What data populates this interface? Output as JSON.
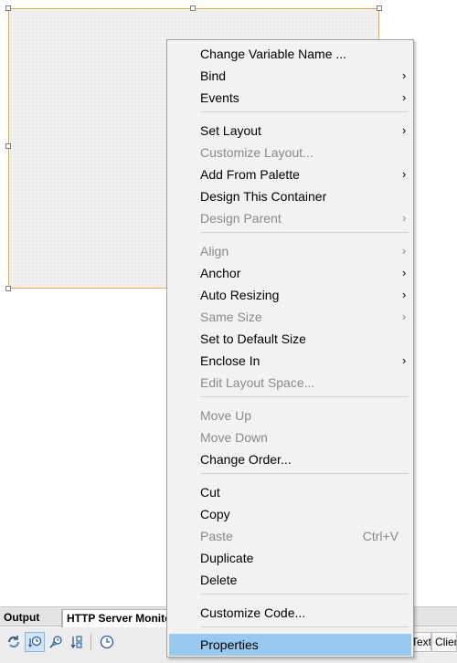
{
  "bottom_panel": {
    "tabs": [
      {
        "label": "Output"
      },
      {
        "label": "HTTP Server Monitor"
      }
    ],
    "toolbar": {
      "buttons": [
        {
          "icon": "reload-icon"
        },
        {
          "icon": "sort-by-time-icon"
        },
        {
          "icon": "sort-alphabetic-icon"
        },
        {
          "icon": "sort-descending-icon"
        },
        {
          "icon": "timestamp-clock-icon"
        }
      ],
      "column_text": "Text",
      "column_client": "Client"
    }
  },
  "context_menu": {
    "items": [
      {
        "label": "Change Variable Name ...",
        "submenu": false,
        "enabled": true
      },
      {
        "label": "Bind",
        "submenu": true,
        "enabled": true
      },
      {
        "label": "Events",
        "submenu": true,
        "enabled": true
      },
      {
        "label": "Set Layout",
        "submenu": true,
        "enabled": true
      },
      {
        "label": "Customize Layout...",
        "submenu": false,
        "enabled": false
      },
      {
        "label": "Add From Palette",
        "submenu": true,
        "enabled": true
      },
      {
        "label": "Design This Container",
        "submenu": false,
        "enabled": true
      },
      {
        "label": "Design Parent",
        "submenu": true,
        "enabled": false
      },
      {
        "label": "Align",
        "submenu": true,
        "enabled": false
      },
      {
        "label": "Anchor",
        "submenu": true,
        "enabled": true
      },
      {
        "label": "Auto Resizing",
        "submenu": true,
        "enabled": true
      },
      {
        "label": "Same Size",
        "submenu": true,
        "enabled": false
      },
      {
        "label": "Set to Default Size",
        "submenu": false,
        "enabled": true
      },
      {
        "label": "Enclose In",
        "submenu": true,
        "enabled": true
      },
      {
        "label": "Edit Layout Space...",
        "submenu": false,
        "enabled": false
      },
      {
        "label": "Move Up",
        "submenu": false,
        "enabled": false
      },
      {
        "label": "Move Down",
        "submenu": false,
        "enabled": false
      },
      {
        "label": "Change Order...",
        "submenu": false,
        "enabled": true
      },
      {
        "label": "Cut",
        "submenu": false,
        "enabled": true
      },
      {
        "label": "Copy",
        "submenu": false,
        "enabled": true
      },
      {
        "label": "Paste",
        "submenu": false,
        "enabled": false,
        "shortcut": "Ctrl+V"
      },
      {
        "label": "Duplicate",
        "submenu": false,
        "enabled": true
      },
      {
        "label": "Delete",
        "submenu": false,
        "enabled": true
      },
      {
        "label": "Customize Code...",
        "submenu": false,
        "enabled": true
      },
      {
        "label": "Properties",
        "submenu": false,
        "enabled": true,
        "highlighted": true
      }
    ],
    "submenu_arrow": "›"
  },
  "colors": {
    "selection_border": "#f0a830",
    "menu_highlight": "#99c9ef",
    "disabled_text": "#8a8a8a"
  }
}
